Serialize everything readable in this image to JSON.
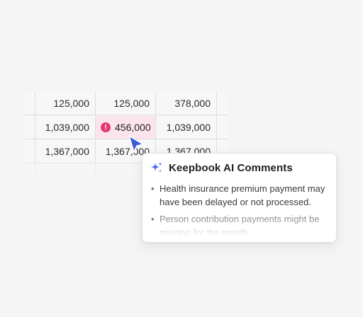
{
  "table": {
    "rows": [
      {
        "c1": "125,000",
        "c2": "125,000",
        "c3": "378,000"
      },
      {
        "c1": "1,039,000",
        "c2": "456,000",
        "c3": "1,039,000",
        "flagged": true
      },
      {
        "c1": "1,367,000",
        "c2": "1,367,000",
        "c3": "1,367,000"
      }
    ],
    "flag_icon": "exclamation-alert-icon",
    "flag_color": "#e53a71",
    "flag_bg": "#fce4ec"
  },
  "cursor": {
    "icon": "pointer-arrow-icon",
    "color": "#3b5bdb"
  },
  "comments": {
    "icon": "sparkle-icon",
    "title": "Keepbook AI Comments",
    "items": [
      "Health insurance premium payment may have been delayed or not processed.",
      "Person contribution payments might be missing for the month."
    ]
  }
}
